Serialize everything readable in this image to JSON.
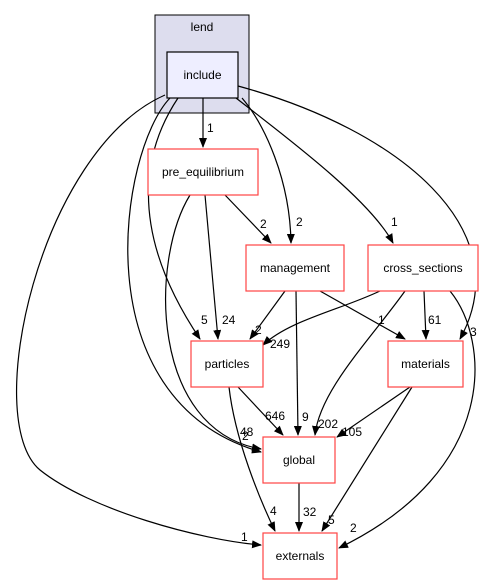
{
  "cluster": {
    "label": "lend",
    "fill": "#ddddee"
  },
  "nodes": {
    "include": {
      "label": "include",
      "fill": "#eeeeff",
      "stroke": "#000000"
    },
    "pre_equilibrium": {
      "label": "pre_equilibrium",
      "stroke": "#ff4444"
    },
    "management": {
      "label": "management",
      "stroke": "#ff4444"
    },
    "cross_sections": {
      "label": "cross_sections",
      "stroke": "#ff4444"
    },
    "particles": {
      "label": "particles",
      "stroke": "#ff4444"
    },
    "materials": {
      "label": "materials",
      "stroke": "#ff4444"
    },
    "global": {
      "label": "global",
      "stroke": "#ff4444"
    },
    "externals": {
      "label": "externals",
      "stroke": "#ff4444"
    }
  },
  "edges": [
    {
      "from": "include",
      "to": "pre_equilibrium",
      "label": "1"
    },
    {
      "from": "include",
      "to": "management",
      "label": "2"
    },
    {
      "from": "include",
      "to": "cross_sections",
      "label": "1"
    },
    {
      "from": "include",
      "to": "particles",
      "label": "5"
    },
    {
      "from": "include",
      "to": "materials",
      "label": "3"
    },
    {
      "from": "include",
      "to": "global",
      "label": "2"
    },
    {
      "from": "include",
      "to": "externals",
      "label": "1"
    },
    {
      "from": "pre_equilibrium",
      "to": "management",
      "label": "2"
    },
    {
      "from": "pre_equilibrium",
      "to": "particles",
      "label": "24"
    },
    {
      "from": "pre_equilibrium",
      "to": "global",
      "label": "48"
    },
    {
      "from": "management",
      "to": "particles",
      "label": "2"
    },
    {
      "from": "management",
      "to": "global",
      "label": "9"
    },
    {
      "from": "management",
      "to": "materials",
      "label": "1"
    },
    {
      "from": "cross_sections",
      "to": "particles",
      "label": "249"
    },
    {
      "from": "cross_sections",
      "to": "global",
      "label": "202"
    },
    {
      "from": "cross_sections",
      "to": "materials",
      "label": "61"
    },
    {
      "from": "cross_sections",
      "to": "externals",
      "label": "2"
    },
    {
      "from": "particles",
      "to": "global",
      "label": "646"
    },
    {
      "from": "particles",
      "to": "externals",
      "label": "4"
    },
    {
      "from": "materials",
      "to": "global",
      "label": "105"
    },
    {
      "from": "materials",
      "to": "externals",
      "label": "5"
    },
    {
      "from": "global",
      "to": "externals",
      "label": "32"
    }
  ]
}
